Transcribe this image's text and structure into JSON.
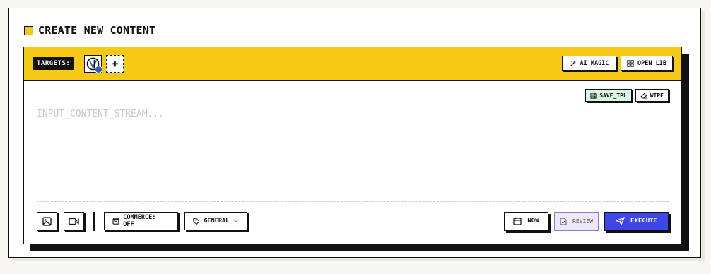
{
  "card": {
    "title": "CREATE NEW CONTENT"
  },
  "toolbar": {
    "targets_label": "TARGETS:",
    "add_target": "+",
    "ai_magic_label": "AI_MAGIC",
    "open_lib_label": "OPEN_LIB"
  },
  "editor": {
    "placeholder": "INPUT_CONTENT_STREAM...",
    "value": "",
    "save_tpl_label": "SAVE_TPL",
    "wipe_label": "WIPE"
  },
  "bottom": {
    "commerce_label": "COMMERCE: OFF",
    "category_label": "GENERAL",
    "now_label": "NOW",
    "review_label": "REVIEW",
    "execute_label": "EXECUTE"
  },
  "icons": {
    "header": "square-marker-icon",
    "avatar": "account-avatar-icon",
    "ai_magic": "sparkles-icon",
    "open_lib": "grid-icon",
    "save_tpl": "save-icon",
    "wipe": "eraser-icon",
    "image": "image-icon",
    "video": "video-icon",
    "commerce": "shopping-bag-icon",
    "category": "tag-icon",
    "dropdown": "chevron-down-icon",
    "now": "calendar-icon",
    "review": "document-check-icon",
    "execute": "send-icon"
  },
  "colors": {
    "accent_yellow": "#f6c915",
    "execute_blue": "#3e46e8",
    "save_green": "#dcf5e4",
    "review_purple": "#eee8fb"
  }
}
